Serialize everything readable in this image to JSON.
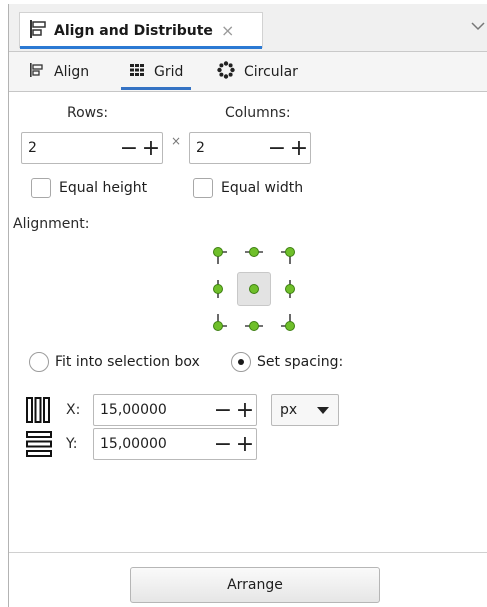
{
  "dock": {
    "tab_title": "Align and Distribute",
    "close_glyph": "×",
    "tab_icon": "align-distribute-icon",
    "menu_icon": "chevron-down-icon"
  },
  "mode_tabs": [
    {
      "label": "Align",
      "icon": "align-icon",
      "active": false
    },
    {
      "label": "Grid",
      "icon": "grid-icon",
      "active": true
    },
    {
      "label": "Circular",
      "icon": "circular-icon",
      "active": false
    }
  ],
  "grid": {
    "rows_label": "Rows:",
    "columns_label": "Columns:",
    "rows_value": "2",
    "columns_value": "2",
    "times_glyph": "×",
    "equal_height_label": "Equal height",
    "equal_width_label": "Equal width",
    "alignment_label": "Alignment:",
    "fit_label": "Fit into selection box",
    "spacing_label": "Set spacing:",
    "x_label": "X:",
    "y_label": "Y:",
    "x_value": "15,00000",
    "y_value": "15,00000",
    "unit": "px",
    "arrange_label": "Arrange",
    "minus_glyph": "−",
    "plus_glyph": "+"
  },
  "colors": {
    "accent": "#2b79d3",
    "anchor_green": "#6fbf2a"
  }
}
